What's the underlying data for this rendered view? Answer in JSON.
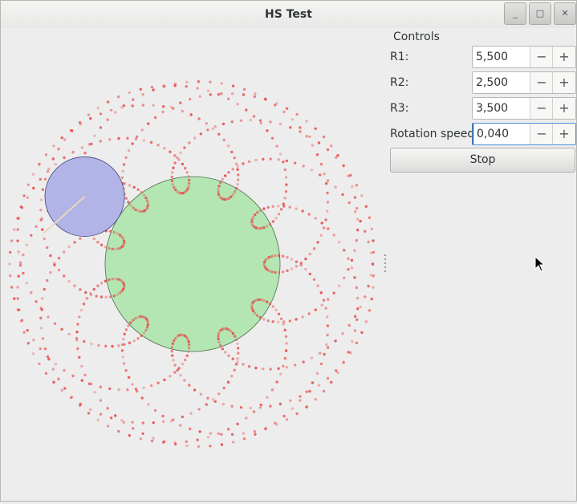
{
  "window": {
    "title": "HS Test",
    "minimize_glyph": "_",
    "maximize_glyph": "□",
    "close_glyph": "✕"
  },
  "controls": {
    "title": "Controls",
    "fields": [
      {
        "label": "R1:",
        "value": "5,500"
      },
      {
        "label": "R2:",
        "value": "2,500"
      },
      {
        "label": "R3:",
        "value": "3,500"
      },
      {
        "label": "Rotation speed:",
        "value": "0,040"
      }
    ],
    "minus_glyph": "−",
    "plus_glyph": "+",
    "stop_label": "Stop"
  },
  "canvas": {
    "fixed_circle_color": "#b4e6b4",
    "rolling_circle_color": "#b2b3e6",
    "trace_color": "#e84848",
    "pen_arm_color": "#e8d8c0"
  }
}
